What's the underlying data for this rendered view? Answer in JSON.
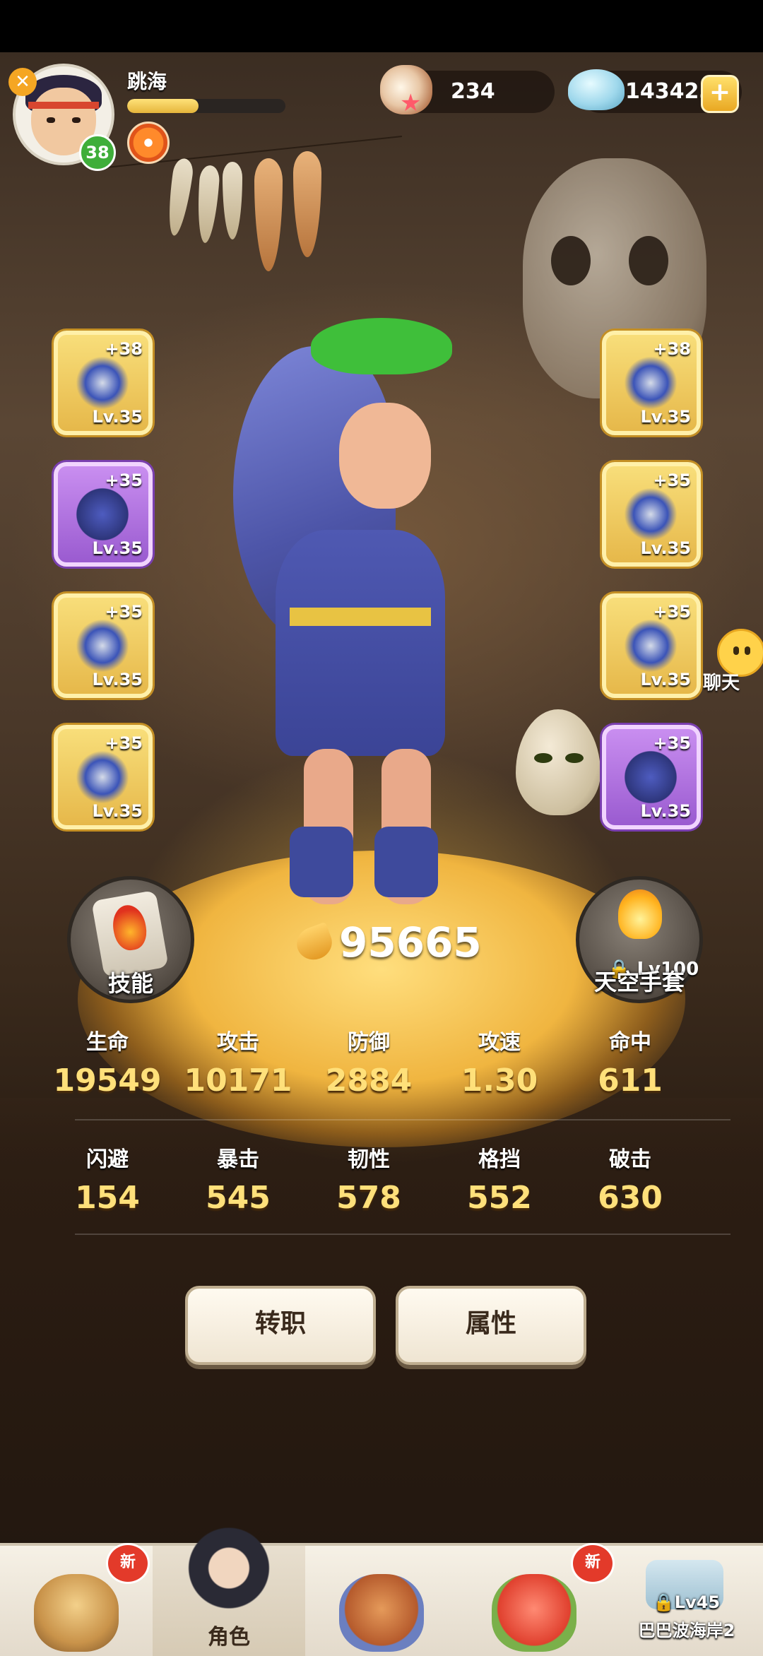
{
  "player": {
    "name": "跳海",
    "level": "38",
    "xp_fraction": 0.45
  },
  "currency": {
    "pearl": "234",
    "shell": "143425",
    "add_label": "+"
  },
  "equipment_left": [
    {
      "plus": "+38",
      "level": "Lv.35",
      "rarity": "gold",
      "icon": "spear-icon"
    },
    {
      "plus": "+35",
      "level": "Lv.35",
      "rarity": "purple",
      "icon": "wolf-helmet-icon"
    },
    {
      "plus": "+35",
      "level": "Lv.35",
      "rarity": "gold",
      "icon": "bracer-icon"
    },
    {
      "plus": "+35",
      "level": "Lv.35",
      "rarity": "gold",
      "icon": "ring-icon"
    }
  ],
  "equipment_right": [
    {
      "plus": "+38",
      "level": "Lv.35",
      "rarity": "gold",
      "icon": "spear-icon"
    },
    {
      "plus": "+35",
      "level": "Lv.35",
      "rarity": "gold",
      "icon": "fur-armor-icon"
    },
    {
      "plus": "+35",
      "level": "Lv.35",
      "rarity": "gold",
      "icon": "leg-guard-icon"
    },
    {
      "plus": "+35",
      "level": "Lv.35",
      "rarity": "purple",
      "icon": "necklace-icon"
    }
  ],
  "power": "95665",
  "skill_label": "技能",
  "glove": {
    "lock_level": "Lv100",
    "label": "天空手套"
  },
  "chat_label": "聊天",
  "stats_row1": [
    {
      "label": "生命",
      "value": "19549"
    },
    {
      "label": "攻击",
      "value": "10171"
    },
    {
      "label": "防御",
      "value": "2884"
    },
    {
      "label": "攻速",
      "value": "1.30"
    },
    {
      "label": "命中",
      "value": "611"
    }
  ],
  "stats_row2": [
    {
      "label": "闪避",
      "value": "154"
    },
    {
      "label": "暴击",
      "value": "545"
    },
    {
      "label": "韧性",
      "value": "578"
    },
    {
      "label": "格挡",
      "value": "552"
    },
    {
      "label": "破击",
      "value": "630"
    }
  ],
  "actions": {
    "job_change": "转职",
    "attributes": "属性"
  },
  "nav": {
    "new_badge": "新",
    "role_label": "角色",
    "locked_level": "Lv45",
    "locked_label": "巴巴波海岸2"
  },
  "colors": {
    "gold_slot": "#f0c95a",
    "purple_slot": "#b476e2",
    "stat_value": "#ffe07a"
  }
}
